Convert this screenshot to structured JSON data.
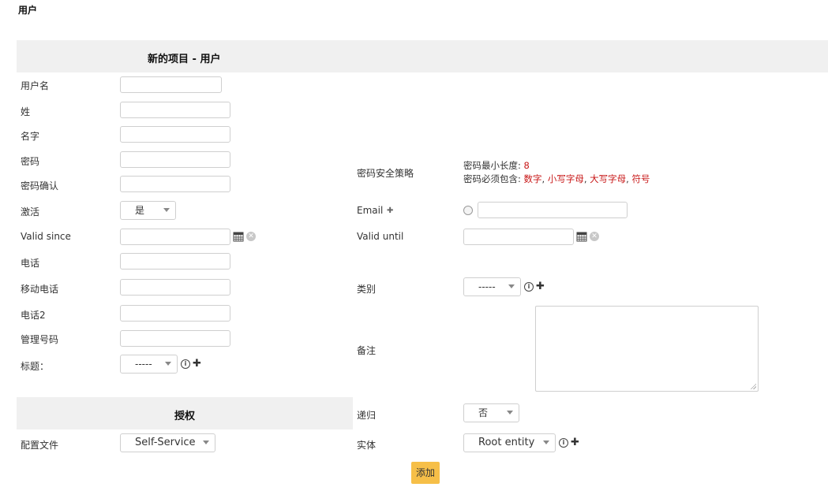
{
  "page": {
    "title": "用户"
  },
  "form": {
    "header": "新的项目 - 用户",
    "labels": {
      "username": "用户名",
      "lastname": "姓",
      "firstname": "名字",
      "password": "密码",
      "password_confirm": "密码确认",
      "active": "激活",
      "valid_since": "Valid since",
      "phone": "电话",
      "mobile": "移动电话",
      "phone2": "电话2",
      "admin_number": "管理号码",
      "title": "标题：",
      "password_policy": "密码安全策略",
      "email": "Email",
      "valid_until": "Valid until",
      "category": "类别",
      "comments": "备注"
    },
    "values": {
      "username": "",
      "lastname": "",
      "firstname": "",
      "password": "",
      "password_confirm": "",
      "active": "是",
      "valid_since": "",
      "phone": "",
      "mobile": "",
      "phone2": "",
      "admin_number": "",
      "title": "-----",
      "email": "",
      "valid_until": "",
      "category": "-----",
      "comments": ""
    },
    "password_policy": {
      "min_length_label": "密码最小长度: ",
      "min_length_value": "8",
      "must_contain_label": "密码必须包含: ",
      "digits": "数字",
      "sep1": ", ",
      "lowercase": "小写字母",
      "sep2": ", ",
      "uppercase": "大写字母",
      "sep3": ", ",
      "symbols": "符号"
    }
  },
  "authorization": {
    "header": "授权",
    "profile_label": "配置文件",
    "profile_value": "Self-Service",
    "recursive_label": "递归",
    "recursive_value": "否",
    "entity_label": "实体",
    "entity_value": "Root entity"
  },
  "actions": {
    "add_label": "添加"
  },
  "icons": {
    "calendar": "calendar-icon",
    "clear": "clear-icon",
    "info": "info-icon",
    "add": "plus-icon"
  },
  "colors": {
    "accent_button": "#f6bf48",
    "policy_red": "#c81818",
    "header_bg": "#f0f0f0"
  }
}
